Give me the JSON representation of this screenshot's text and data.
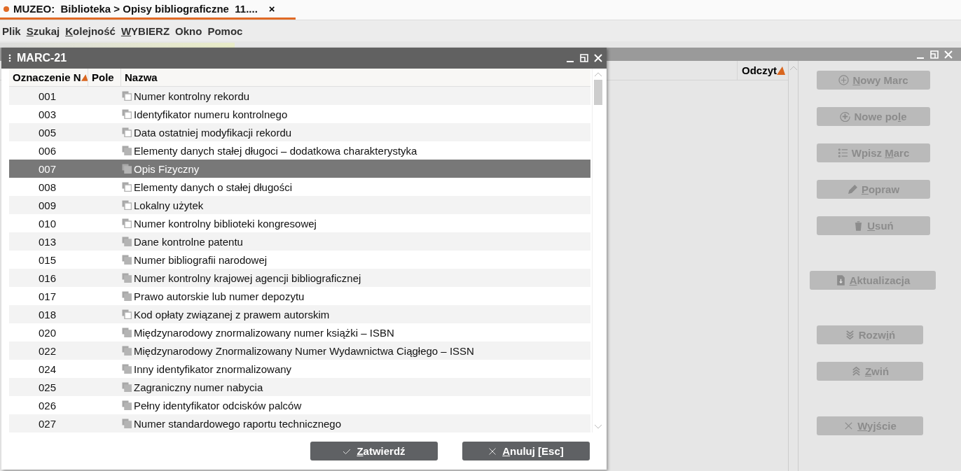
{
  "app_tab": {
    "title": "MUZEO:  Biblioteka > Opisy bibliograficzne  11....",
    "close": "×"
  },
  "menu": [
    {
      "before": "Plik"
    },
    {
      "key": "S",
      "after": "zukaj"
    },
    {
      "key": "K",
      "after": "olejność"
    },
    {
      "key": "W",
      "after": "YBIERZ"
    },
    {
      "before": "Okno"
    },
    {
      "before": "Pomoc"
    }
  ],
  "back_window": {
    "columns": [
      "Odczyt"
    ],
    "button_groups": [
      [
        {
          "key": "N",
          "after": "owy Marc",
          "disabled": true
        },
        {
          "before": "Nowe po",
          "key": "l",
          "after": "e",
          "disabled": true
        },
        {
          "before": "Wpisz ",
          "key": "M",
          "after": "arc",
          "disabled": true
        },
        {
          "key": "P",
          "after": "opraw",
          "disabled": true
        },
        {
          "key": "U",
          "after": "suń",
          "disabled": true
        }
      ],
      [
        {
          "key": "A",
          "after": "ktualizacja",
          "disabled": true
        }
      ],
      [
        {
          "before": "Rozw",
          "key": "i",
          "after": "ń",
          "disabled": true
        },
        {
          "key": "Z",
          "after": "wiń",
          "disabled": true
        }
      ],
      [
        {
          "key": "W",
          "after": "yjście",
          "disabled": true
        }
      ]
    ]
  },
  "dialog": {
    "title": "MARC-21",
    "columns": [
      "Oznaczenie N",
      "Pole",
      "Nazwa"
    ],
    "rows": [
      {
        "code": "001",
        "name": "Numer kontrolny rekordu",
        "repeatable": false,
        "selected": false
      },
      {
        "code": "003",
        "name": "Identyfikator numeru kontrolnego",
        "repeatable": false,
        "selected": false
      },
      {
        "code": "005",
        "name": "Data ostatniej modyfikacji rekordu",
        "repeatable": false,
        "selected": false
      },
      {
        "code": "006",
        "name": "Elementy danych stałej długoci – dodatkowa charakterystyka",
        "repeatable": true,
        "selected": false
      },
      {
        "code": "007",
        "name": "Opis Fizyczny",
        "repeatable": true,
        "selected": true
      },
      {
        "code": "008",
        "name": "Elementy danych o stałej długości",
        "repeatable": false,
        "selected": false
      },
      {
        "code": "009",
        "name": "Lokalny użytek",
        "repeatable": false,
        "selected": false
      },
      {
        "code": "010",
        "name": "Numer kontrolny biblioteki kongresowej",
        "repeatable": false,
        "selected": false
      },
      {
        "code": "013",
        "name": "Dane kontrolne patentu",
        "repeatable": true,
        "selected": false
      },
      {
        "code": "015",
        "name": "Numer bibliografii narodowej",
        "repeatable": true,
        "selected": false
      },
      {
        "code": "016",
        "name": "Numer kontrolny krajowej agencji bibliograficznej",
        "repeatable": true,
        "selected": false
      },
      {
        "code": "017",
        "name": "Prawo autorskie lub numer depozytu",
        "repeatable": true,
        "selected": false
      },
      {
        "code": "018",
        "name": "Kod opłaty związanej z prawem autorskim",
        "repeatable": false,
        "selected": false
      },
      {
        "code": "020",
        "name": "Międzynarodowy znormalizowany numer książki – ISBN",
        "repeatable": true,
        "selected": false
      },
      {
        "code": "022",
        "name": "Międzynarodowy Znormalizowany Numer Wydawnictwa Ciągłego – ISSN",
        "repeatable": true,
        "selected": false
      },
      {
        "code": "024",
        "name": "Inny identyfikator znormalizowany",
        "repeatable": true,
        "selected": false
      },
      {
        "code": "025",
        "name": "Zagraniczny numer nabycia",
        "repeatable": true,
        "selected": false
      },
      {
        "code": "026",
        "name": "Pełny identyfikator odcisków palców",
        "repeatable": true,
        "selected": false
      },
      {
        "code": "027",
        "name": "Numer standardowego raportu technicznego",
        "repeatable": true,
        "selected": false
      }
    ],
    "buttons": [
      {
        "key": "Z",
        "after": "atwierdź"
      },
      {
        "key": "A",
        "after": "nuluj [Esc]"
      }
    ]
  }
}
